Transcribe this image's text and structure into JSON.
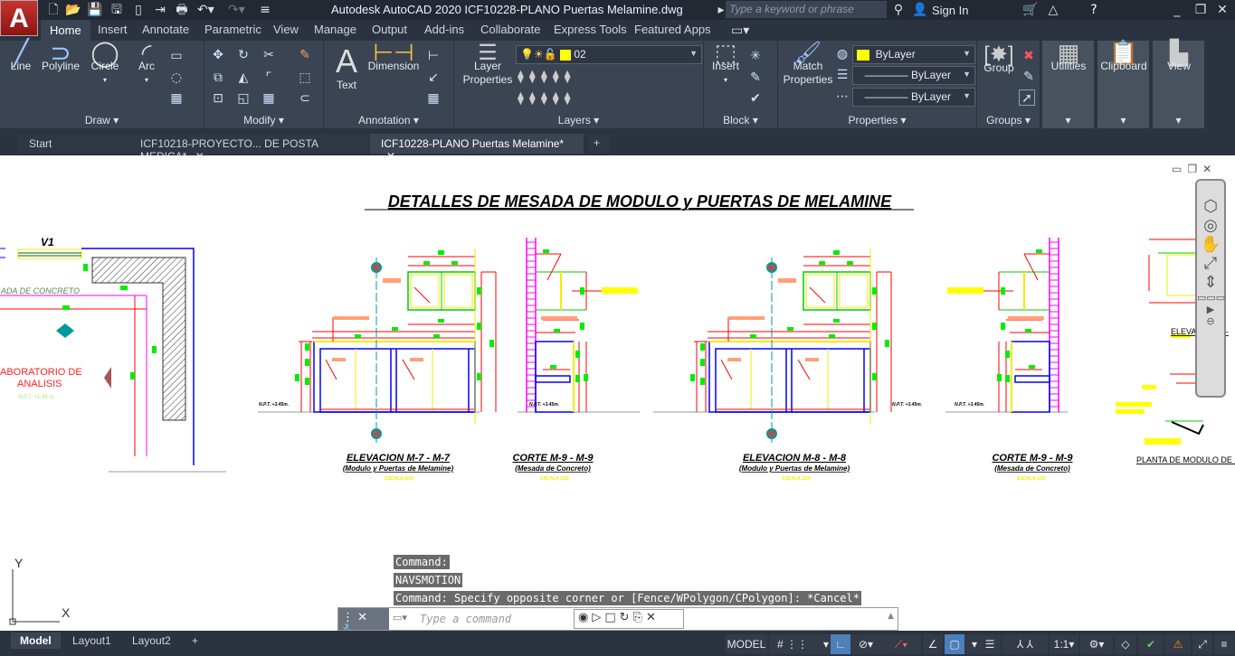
{
  "app": {
    "logo_letter": "A",
    "title": "Autodesk AutoCAD 2020    ICF10228-PLANO Puertas Melamine.dwg"
  },
  "search": {
    "placeholder": "Type a keyword or phrase"
  },
  "account": {
    "sign_in": "Sign In"
  },
  "ribbon_tabs": [
    "Home",
    "Insert",
    "Annotate",
    "Parametric",
    "View",
    "Manage",
    "Output",
    "Add-ins",
    "Collaborate",
    "Express Tools",
    "Featured Apps"
  ],
  "panels": {
    "draw": {
      "title": "Draw",
      "tools": [
        "Line",
        "Polyline",
        "Circle",
        "Arc"
      ]
    },
    "modify": {
      "title": "Modify"
    },
    "annotation": {
      "title": "Annotation",
      "tools": [
        "Text",
        "Dimension"
      ]
    },
    "layers": {
      "title": "Layers",
      "layer_properties": "Layer Properties",
      "current_layer": "02",
      "layer_color": "#ffff00"
    },
    "block": {
      "title": "Block",
      "insert": "Insert"
    },
    "properties": {
      "title": "Properties",
      "match": "Match Properties",
      "color": "ByLayer",
      "linetype": "ByLayer",
      "lineweight": "ByLayer"
    },
    "groups": {
      "title": "Groups",
      "group": "Group"
    },
    "utilities": "Utilities",
    "clipboard": "Clipboard",
    "view": "View"
  },
  "doc_tabs": [
    {
      "label": "Start"
    },
    {
      "label": "ICF10218-PROYECTO... DE POSTA MEDICA*"
    },
    {
      "label": "ICF10228-PLANO Puertas Melamine*",
      "active": true
    }
  ],
  "drawing": {
    "title": "DETALLES DE MESADA DE MODULO y PUERTAS DE MELAMINE",
    "v1": "V1",
    "room1": "ABORATORIO DE",
    "room2": "ANALISIS",
    "npt_left": "N.P.T. +1.45 m.",
    "mesada": "ADA DE CONCRETO",
    "npt": "N.P.T. +3.45m.",
    "elev1": "ELEVACION M-7 - M-7",
    "elev1_sub": "(Modulo y Puertas de Melamine)",
    "corte1": "CORTE M-9 - M-9",
    "corte1_sub": "(Mesada de Concreto)",
    "elev2": "ELEVACION M-8 - M-8",
    "elev2_sub": "(Modulo y Puertas de Melamine)",
    "corte2": "CORTE M-9 - M-9",
    "corte2_sub": "(Mesada de Concreto)",
    "scale": "ESCALA 1/20",
    "elev_right": "ELEVACION M-",
    "planta": "PLANTA DE MODULO DE I",
    "ucs_y": "Y",
    "ucs_x": "X"
  },
  "command": {
    "history": [
      "Command:",
      "NAVSMOTION",
      "Command: Specify opposite corner or [Fence/WPolygon/CPolygon]: *Cancel*"
    ],
    "placeholder": "Type a command"
  },
  "layout_tabs": [
    "Model",
    "Layout1",
    "Layout2"
  ],
  "status": {
    "model": "MODEL",
    "scale": "1:1"
  }
}
